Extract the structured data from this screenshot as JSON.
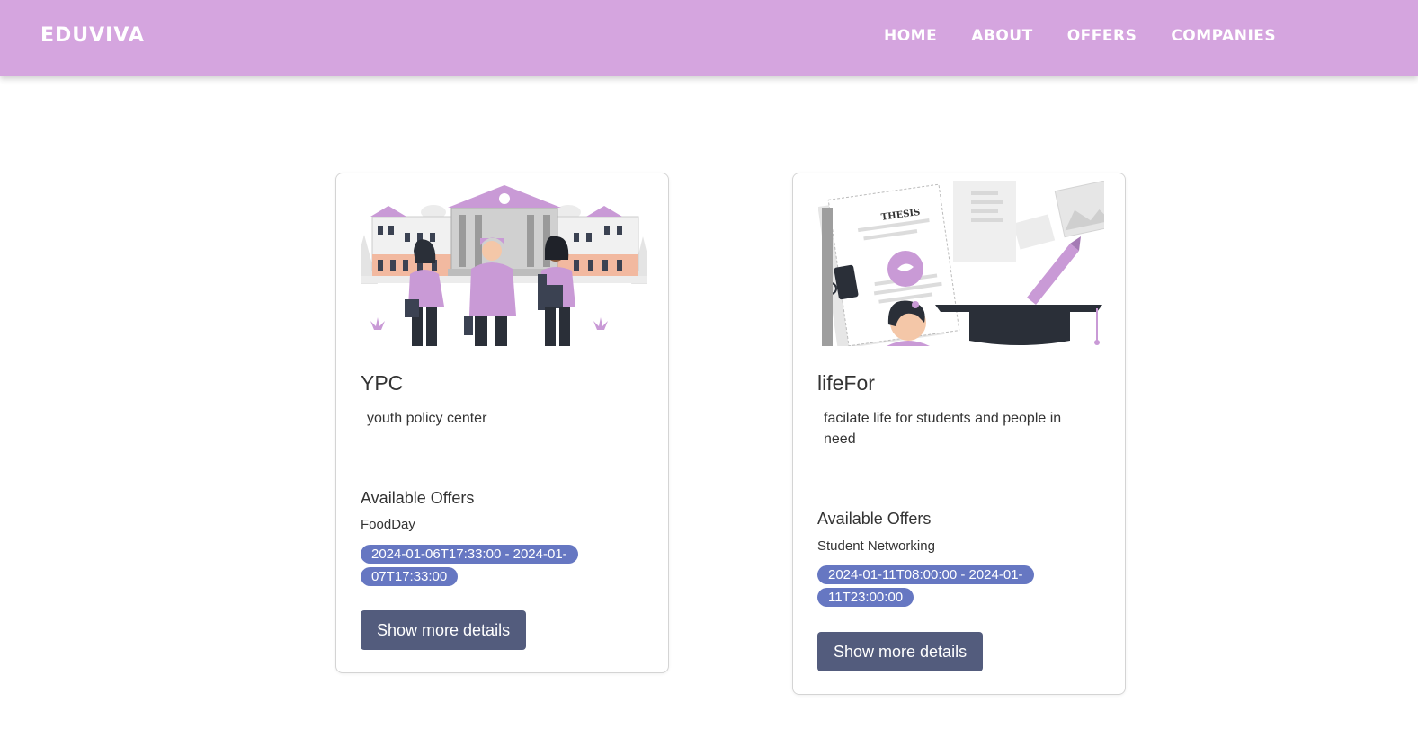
{
  "navbar": {
    "brand": "EDUVIVA",
    "links": [
      "HOME",
      "ABOUT",
      "OFFERS",
      "COMPANIES"
    ]
  },
  "cards": [
    {
      "title": "YPC",
      "description": "youth policy center",
      "offers_heading": "Available Offers",
      "offer_name": "FoodDay",
      "offer_dates": "2024-01-06T17:33:00 - 2024-01-07T17:33:00",
      "button_label": "Show more details",
      "illustration": "students-campus-illustration"
    },
    {
      "title": "lifeFor",
      "description": "facilate life for students and people in need",
      "offers_heading": "Available Offers",
      "offer_name": "Student Networking",
      "offer_dates": "2024-01-11T08:00:00 - 2024-01-11T23:00:00",
      "button_label": "Show more details",
      "illustration": "thesis-graduation-illustration",
      "illustration_text": "THESIS"
    }
  ],
  "colors": {
    "navbar_bg": "#d5a5df",
    "accent_purple": "#c99ad6",
    "date_badge": "#6677c2",
    "button_bg": "#535c7d"
  }
}
